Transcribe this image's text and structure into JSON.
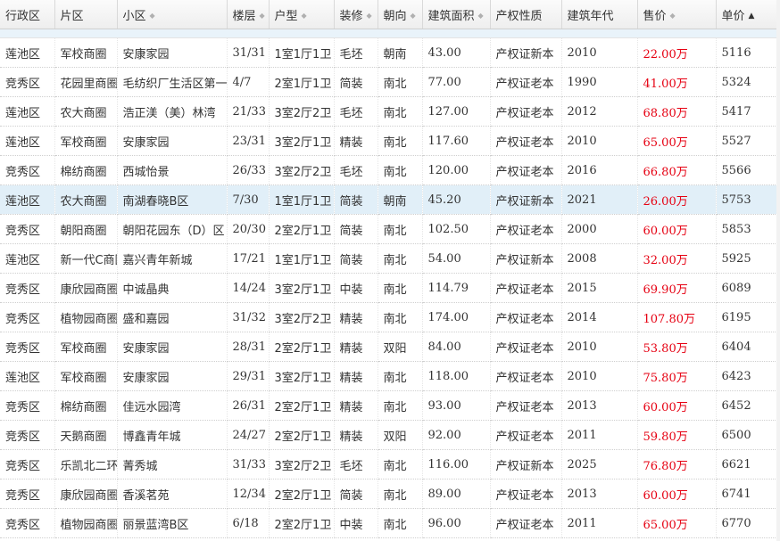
{
  "columns": [
    {
      "key": "district",
      "label": "行政区",
      "sort": ""
    },
    {
      "key": "area",
      "label": "片区",
      "sort": ""
    },
    {
      "key": "community",
      "label": "小区",
      "sort": "◆"
    },
    {
      "key": "floor",
      "label": "楼层",
      "sort": "◆"
    },
    {
      "key": "layout",
      "label": "户型",
      "sort": "◆"
    },
    {
      "key": "decoration",
      "label": "装修",
      "sort": "◆"
    },
    {
      "key": "orientation",
      "label": "朝向",
      "sort": "◆"
    },
    {
      "key": "building_area",
      "label": "建筑面积",
      "sort": "◆"
    },
    {
      "key": "property_type",
      "label": "产权性质",
      "sort": ""
    },
    {
      "key": "year",
      "label": "建筑年代",
      "sort": ""
    },
    {
      "key": "price",
      "label": "售价",
      "sort": "◆"
    },
    {
      "key": "unit_price",
      "label": "单价",
      "sort": "▲"
    }
  ],
  "rows": [
    {
      "district": "莲池区",
      "area": "军校商圈",
      "community": "安康家园",
      "floor": "31/31",
      "layout": "1室1厅1卫",
      "decoration": "毛坯",
      "orientation": "朝南",
      "building_area": "43.00",
      "property_type": "产权证新本",
      "year": "2010",
      "price": "22.00万",
      "unit_price": "5116"
    },
    {
      "district": "竞秀区",
      "area": "花园里商圈",
      "community": "毛纺织厂生活区第一",
      "floor": "4/7",
      "layout": "2室1厅1卫",
      "decoration": "简装",
      "orientation": "南北",
      "building_area": "77.00",
      "property_type": "产权证老本",
      "year": "1990",
      "price": "41.00万",
      "unit_price": "5324"
    },
    {
      "district": "莲池区",
      "area": "农大商圈",
      "community": "浩正渼（美）林湾",
      "floor": "21/33",
      "layout": "3室2厅2卫",
      "decoration": "毛坯",
      "orientation": "南北",
      "building_area": "127.00",
      "property_type": "产权证老本",
      "year": "2012",
      "price": "68.80万",
      "unit_price": "5417"
    },
    {
      "district": "莲池区",
      "area": "军校商圈",
      "community": "安康家园",
      "floor": "23/31",
      "layout": "3室2厅1卫",
      "decoration": "精装",
      "orientation": "南北",
      "building_area": "117.60",
      "property_type": "产权证老本",
      "year": "2010",
      "price": "65.00万",
      "unit_price": "5527"
    },
    {
      "district": "竞秀区",
      "area": "棉纺商圈",
      "community": "西城怡景",
      "floor": "26/33",
      "layout": "3室2厅2卫",
      "decoration": "毛坯",
      "orientation": "南北",
      "building_area": "120.00",
      "property_type": "产权证老本",
      "year": "2016",
      "price": "66.80万",
      "unit_price": "5566"
    },
    {
      "district": "莲池区",
      "area": "农大商圈",
      "community": "南湖春晓B区",
      "floor": "7/30",
      "layout": "1室1厅1卫",
      "decoration": "简装",
      "orientation": "朝南",
      "building_area": "45.20",
      "property_type": "产权证新本",
      "year": "2021",
      "price": "26.00万",
      "unit_price": "5753"
    },
    {
      "district": "竞秀区",
      "area": "朝阳商圈",
      "community": "朝阳花园东（D）区",
      "floor": "20/30",
      "layout": "2室2厅1卫",
      "decoration": "简装",
      "orientation": "南北",
      "building_area": "102.50",
      "property_type": "产权证老本",
      "year": "2000",
      "price": "60.00万",
      "unit_price": "5853"
    },
    {
      "district": "莲池区",
      "area": "新一代C商圈",
      "community": "嘉兴青年新城",
      "floor": "17/21",
      "layout": "1室1厅1卫",
      "decoration": "简装",
      "orientation": "南北",
      "building_area": "54.00",
      "property_type": "产权证新本",
      "year": "2008",
      "price": "32.00万",
      "unit_price": "5925"
    },
    {
      "district": "竞秀区",
      "area": "康欣园商圈",
      "community": "中诚晶典",
      "floor": "14/24",
      "layout": "3室2厅1卫",
      "decoration": "中装",
      "orientation": "南北",
      "building_area": "114.79",
      "property_type": "产权证老本",
      "year": "2015",
      "price": "69.90万",
      "unit_price": "6089"
    },
    {
      "district": "竞秀区",
      "area": "植物园商圈",
      "community": "盛和嘉园",
      "floor": "31/32",
      "layout": "3室2厅2卫",
      "decoration": "精装",
      "orientation": "南北",
      "building_area": "174.00",
      "property_type": "产权证老本",
      "year": "2014",
      "price": "107.80万",
      "unit_price": "6195"
    },
    {
      "district": "竞秀区",
      "area": "军校商圈",
      "community": "安康家园",
      "floor": "28/31",
      "layout": "2室2厅1卫",
      "decoration": "精装",
      "orientation": "双阳",
      "building_area": "84.00",
      "property_type": "产权证老本",
      "year": "2010",
      "price": "53.80万",
      "unit_price": "6404"
    },
    {
      "district": "莲池区",
      "area": "军校商圈",
      "community": "安康家园",
      "floor": "29/31",
      "layout": "3室2厅1卫",
      "decoration": "精装",
      "orientation": "南北",
      "building_area": "118.00",
      "property_type": "产权证老本",
      "year": "2010",
      "price": "75.80万",
      "unit_price": "6423"
    },
    {
      "district": "竞秀区",
      "area": "棉纺商圈",
      "community": "佳远水园湾",
      "floor": "26/31",
      "layout": "2室2厅1卫",
      "decoration": "精装",
      "orientation": "南北",
      "building_area": "93.00",
      "property_type": "产权证老本",
      "year": "2013",
      "price": "60.00万",
      "unit_price": "6452"
    },
    {
      "district": "竞秀区",
      "area": "天鹅商圈",
      "community": "博鑫青年城",
      "floor": "24/27",
      "layout": "2室2厅1卫",
      "decoration": "精装",
      "orientation": "双阳",
      "building_area": "92.00",
      "property_type": "产权证老本",
      "year": "2011",
      "price": "59.80万",
      "unit_price": "6500"
    },
    {
      "district": "竞秀区",
      "area": "乐凯北二环",
      "community": "菁秀城",
      "floor": "31/33",
      "layout": "3室2厅2卫",
      "decoration": "毛坯",
      "orientation": "南北",
      "building_area": "116.00",
      "property_type": "产权证新本",
      "year": "2025",
      "price": "76.80万",
      "unit_price": "6621"
    },
    {
      "district": "竞秀区",
      "area": "康欣园商圈",
      "community": "香溪茗苑",
      "floor": "12/34",
      "layout": "2室2厅1卫",
      "decoration": "简装",
      "orientation": "南北",
      "building_area": "89.00",
      "property_type": "产权证老本",
      "year": "2013",
      "price": "60.00万",
      "unit_price": "6741"
    },
    {
      "district": "竞秀区",
      "area": "植物园商圈",
      "community": "丽景蓝湾B区",
      "floor": "6/18",
      "layout": "2室2厅1卫",
      "decoration": "中装",
      "orientation": "南北",
      "building_area": "96.00",
      "property_type": "产权证老本",
      "year": "2011",
      "price": "65.00万",
      "unit_price": "6770"
    }
  ],
  "selected_row": 5
}
